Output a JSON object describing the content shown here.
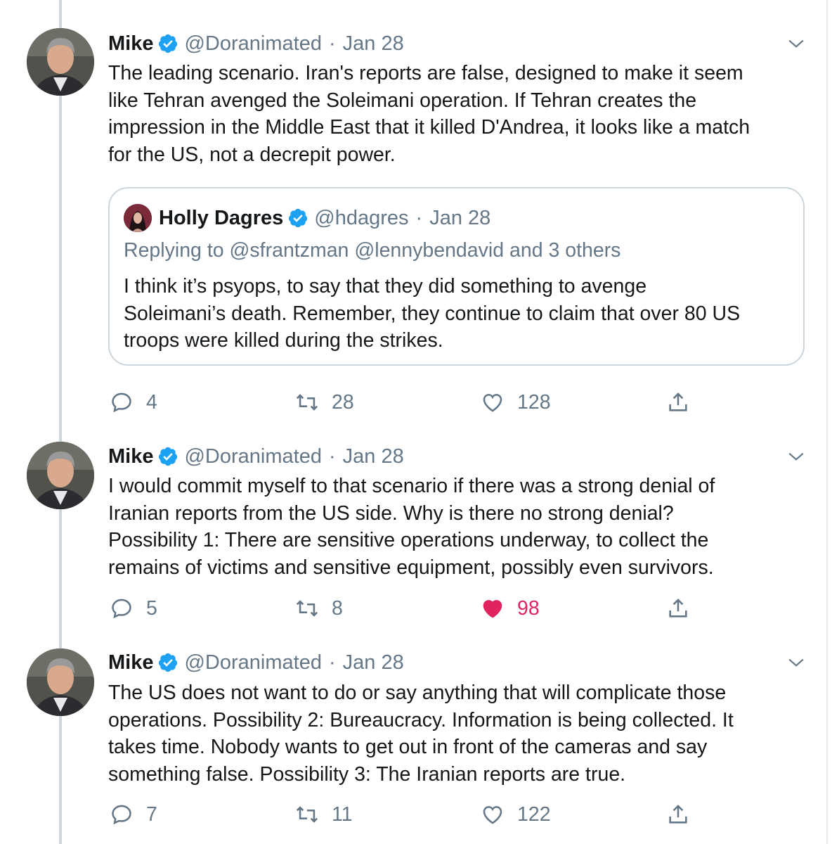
{
  "thread": {
    "tweets": [
      {
        "author": "Mike",
        "handle": "@Doranimated",
        "separator": "·",
        "date": "Jan 28",
        "lines": [
          "The leading scenario. Iran's reports are false, designed to make it seem",
          "like Tehran avenged the Soleimani operation. If Tehran creates the",
          "impression in the Middle East that it killed D'Andrea, it looks like a match",
          "for the US, not a decrepit power."
        ],
        "quote": {
          "author": "Holly Dagres",
          "handle": "@hdagres",
          "separator": "·",
          "date": "Jan 28",
          "replying_to": "Replying to @sfrantzman @lennybendavid and 3 others",
          "lines": [
            "I think it’s psyops, to say that they did something to avenge",
            "Soleimani’s death. Remember, they continue to claim that over 80 US",
            "troops were killed during the strikes."
          ]
        },
        "replies": "4",
        "retweets": "28",
        "likes": "128",
        "liked": false
      },
      {
        "author": "Mike",
        "handle": "@Doranimated",
        "separator": "·",
        "date": "Jan 28",
        "lines": [
          "I would commit myself to that scenario if there was a strong denial of",
          "Iranian reports from the US side. Why is there no strong denial?",
          "Possibility 1: There are sensitive operations underway, to collect the",
          "remains of victims and sensitive equipment, possibly even survivors."
        ],
        "replies": "5",
        "retweets": "8",
        "likes": "98",
        "liked": true
      },
      {
        "author": "Mike",
        "handle": "@Doranimated",
        "separator": "·",
        "date": "Jan 28",
        "lines": [
          "The US does not want to do or say anything that will complicate those",
          "operations. Possibility 2: Bureaucracy. Information is being collected. It",
          "takes time. Nobody wants to get out in front of the cameras and say",
          "something false. Possibility 3: The Iranian reports are true."
        ],
        "replies": "7",
        "retweets": "11",
        "likes": "122",
        "liked": false
      }
    ]
  },
  "colors": {
    "text": "#14171a",
    "secondary": "#657786",
    "verified": "#1da1f2",
    "like_active": "#e0245e",
    "border": "#ccd6dd"
  },
  "icons": {
    "reply": "reply-icon",
    "retweet": "retweet-icon",
    "like": "heart-icon",
    "share": "share-icon",
    "verified": "verified-badge-icon",
    "menu": "chevron-down-icon"
  }
}
